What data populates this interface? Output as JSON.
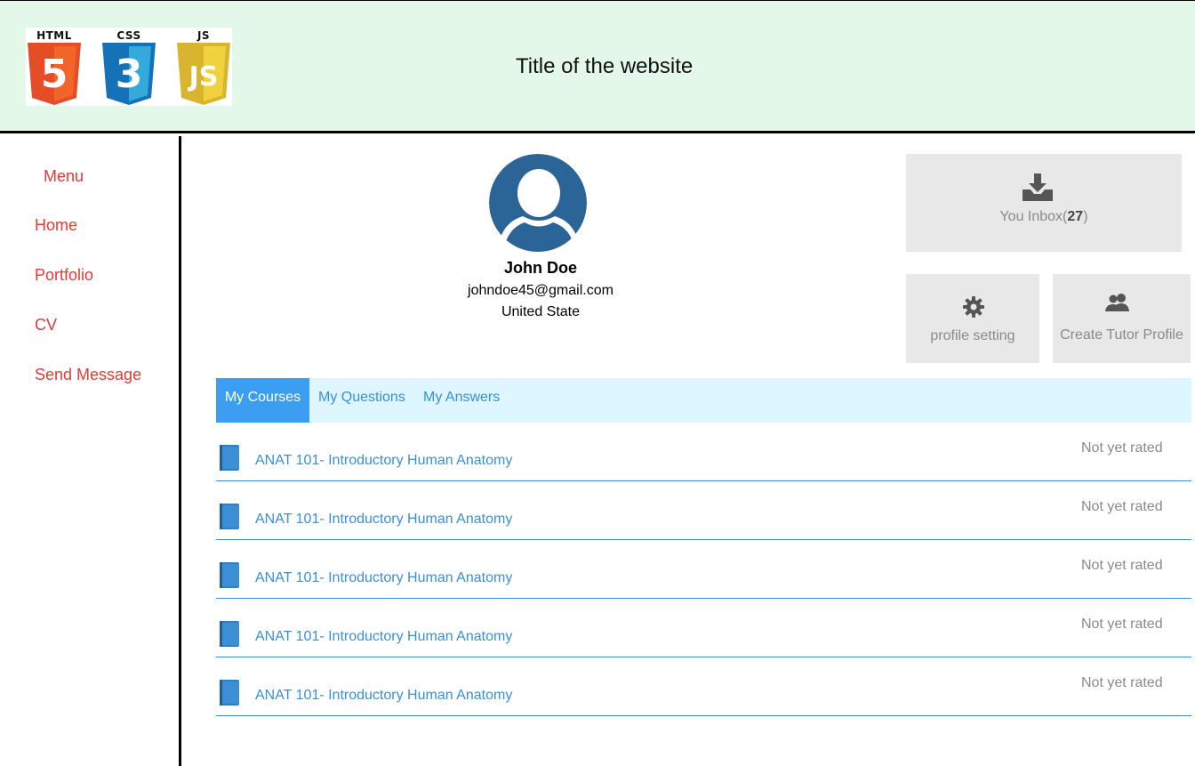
{
  "header": {
    "logos": [
      {
        "label": "HTML",
        "color": "#e44d26",
        "glyph": "5"
      },
      {
        "label": "CSS",
        "color": "#1572b6",
        "glyph": "3"
      },
      {
        "label": "JS",
        "color": "#d9b52f",
        "glyph": "JS"
      }
    ],
    "title": "Title of the website"
  },
  "sidebar": {
    "menu_title": "Menu",
    "items": [
      {
        "label": "Home"
      },
      {
        "label": "Portfolio"
      },
      {
        "label": "CV"
      },
      {
        "label": "Send Message"
      }
    ]
  },
  "profile": {
    "name": "John Doe",
    "email": "johndoe45@gmail.com",
    "country": "United State"
  },
  "actions": {
    "inbox_label": "You Inbox(",
    "inbox_count": "27",
    "inbox_close": ")",
    "profile_setting": "profile setting",
    "create_tutor": "Create Tutor Profile"
  },
  "tabs": [
    {
      "label": "My Courses",
      "active": true
    },
    {
      "label": "My Questions",
      "active": false
    },
    {
      "label": "My Answers",
      "active": false
    }
  ],
  "courses": [
    {
      "title": "ANAT 101- Introductory Human Anatomy",
      "rating": "Not yet rated"
    },
    {
      "title": "ANAT 101- Introductory Human Anatomy",
      "rating": "Not yet rated"
    },
    {
      "title": "ANAT 101- Introductory Human Anatomy",
      "rating": "Not yet rated"
    },
    {
      "title": "ANAT 101- Introductory Human Anatomy",
      "rating": "Not yet rated"
    },
    {
      "title": "ANAT 101- Introductory Human Anatomy",
      "rating": "Not yet rated"
    }
  ],
  "colors": {
    "header_bg": "#e4f8ea",
    "nav_text": "#e53935",
    "link_blue": "#3a8fd6",
    "tab_active": "#3c9ef0",
    "tab_bar": "#ddf6ff",
    "avatar": "#2b6496",
    "box_bg": "#e8e8e8"
  },
  "icons": {
    "inbox": "download-tray-icon",
    "setting": "gear-icon",
    "tutor": "users-icon",
    "course": "book-icon",
    "avatar": "user-avatar-icon"
  }
}
